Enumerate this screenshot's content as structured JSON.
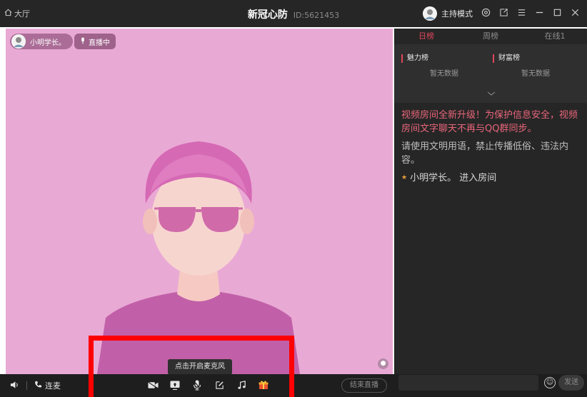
{
  "titlebar": {
    "lobby_label": "大厅",
    "room_name": "新冠心防",
    "room_id": "ID:5621453",
    "host_mode_label": "主持模式",
    "icons": [
      "home-icon",
      "settings-icon",
      "external-icon",
      "menu-icon",
      "minimize-icon",
      "maximize-icon",
      "close-icon"
    ]
  },
  "stage": {
    "host_name": "小明学长。",
    "live_label": "直播中",
    "background_color": "#e9a9d5"
  },
  "tooltip": {
    "text": "点击开启麦克风"
  },
  "bottombar": {
    "connect_label": "连麦",
    "end_live_label": "结束直播",
    "tools": [
      "camera-icon",
      "screen-share-icon",
      "microphone-icon",
      "edit-icon",
      "music-icon",
      "gift-icon"
    ]
  },
  "right_panel": {
    "tabs": [
      {
        "label": "日榜",
        "active": true
      },
      {
        "label": "周榜",
        "active": false
      },
      {
        "label": "在线1",
        "active": false
      }
    ],
    "charm_title": "魅力榜",
    "charm_empty": "暂无数据",
    "wealth_title": "财富榜",
    "wealth_empty": "暂无数据",
    "announcement": "视频房间全新升级！为保护信息安全，视频房间文字聊天不再与QQ群同步。",
    "rules": "请使用文明用语，禁止传播低俗、违法内容。",
    "enter_message": "小明学长。 进入房间"
  },
  "chat_input": {
    "placeholder": "",
    "send_label": "发送"
  },
  "colors": {
    "accent": "#e0465a",
    "announcement": "#e9667a",
    "highlight": "#ff0000"
  }
}
